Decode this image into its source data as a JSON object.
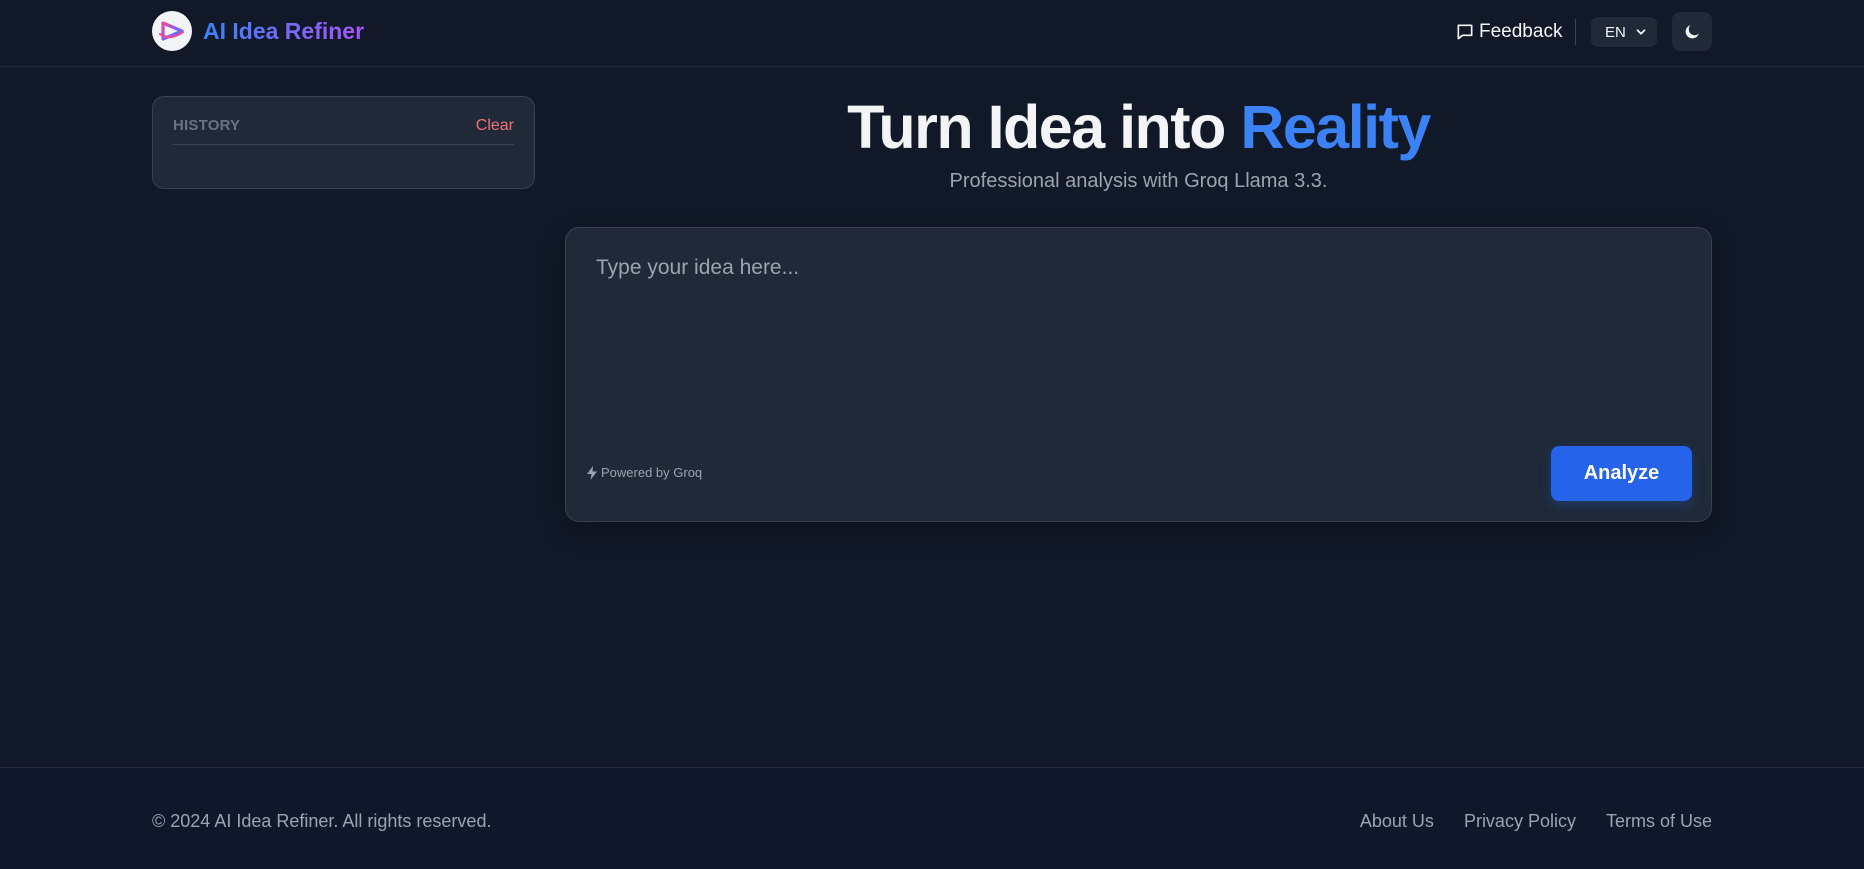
{
  "header": {
    "brand_title": "AI Idea Refiner",
    "feedback_label": "Feedback",
    "language_selected": "EN",
    "icons": {
      "logo": "play-logo-icon",
      "feedback": "message-square-icon",
      "language": "chevron-down-icon",
      "theme": "moon-icon"
    }
  },
  "history": {
    "title": "HISTORY",
    "clear_label": "Clear",
    "items": []
  },
  "hero": {
    "title_main": "Turn Idea into ",
    "title_accent": "Reality",
    "subtitle": "Professional analysis with Groq Llama 3.3."
  },
  "input": {
    "placeholder": "Type your idea here...",
    "value": "",
    "powered_by": "Powered by Groq",
    "analyze_label": "Analyze"
  },
  "footer": {
    "copyright": "© 2024 AI Idea Refiner. All rights reserved.",
    "links": [
      "About Us",
      "Privacy Policy",
      "Terms of Use"
    ]
  },
  "colors": {
    "background": "#111827",
    "card": "#1f2937",
    "accent": "#3b82f6",
    "button": "#2563eb",
    "danger": "#f87171"
  }
}
